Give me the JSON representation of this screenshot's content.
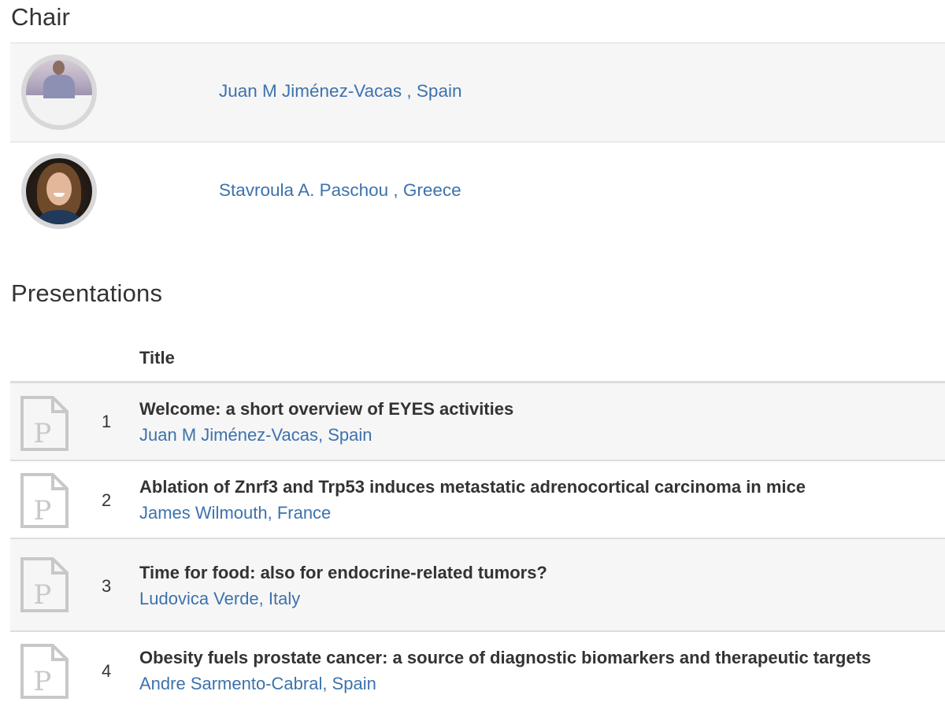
{
  "chair": {
    "heading": "Chair",
    "people": [
      {
        "name": "Juan M Jiménez-Vacas , Spain"
      },
      {
        "name": "Stavroula A. Paschou , Greece"
      }
    ]
  },
  "presentations": {
    "heading": "Presentations",
    "column_title": "Title",
    "icon": "document-p-icon",
    "rows": [
      {
        "number": "1",
        "title": "Welcome: a short overview of EYES activities",
        "author": "Juan M Jiménez-Vacas, Spain"
      },
      {
        "number": "2",
        "title": "Ablation of Znrf3 and Trp53 induces metastatic adrenocortical carcinoma in mice",
        "author": "James Wilmouth, France"
      },
      {
        "number": "3",
        "title": "Time for food: also for endocrine-related tumors?",
        "author": "Ludovica Verde, Italy"
      },
      {
        "number": "4",
        "title": "Obesity fuels prostate cancer: a source of diagnostic biomarkers and therapeutic targets",
        "author": "Andre Sarmento-Cabral, Spain"
      }
    ]
  },
  "colors": {
    "link": "#3d72ad",
    "text": "#333333",
    "row_shade": "#f6f6f6",
    "border": "#dddddd"
  }
}
